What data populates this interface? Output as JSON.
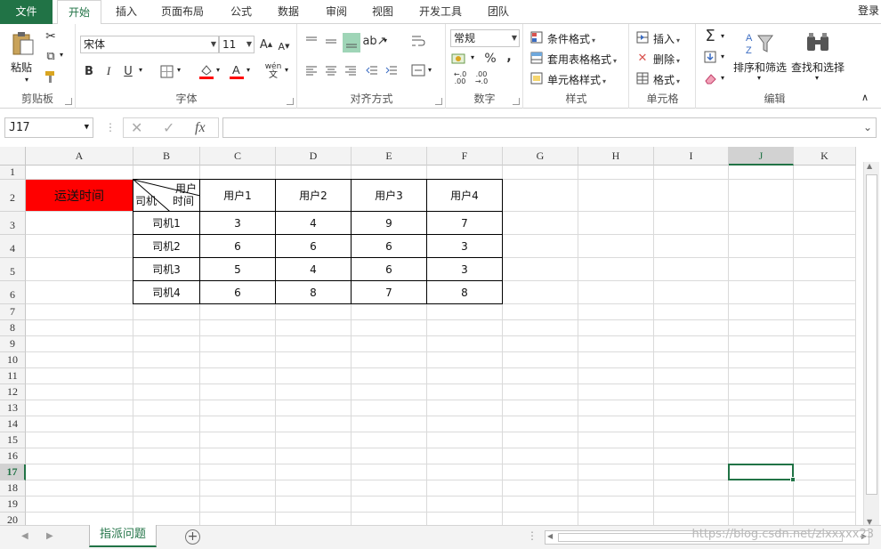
{
  "tabs": {
    "file": "文件",
    "home": "开始",
    "insert": "插入",
    "page_layout": "页面布局",
    "formulas": "公式",
    "data": "数据",
    "review": "审阅",
    "view": "视图",
    "developer": "开发工具",
    "team": "团队",
    "login": "登录"
  },
  "ribbon": {
    "clipboard": {
      "name": "剪贴板",
      "paste": "粘贴"
    },
    "font": {
      "name": "字体",
      "font_name": "宋体",
      "font_size": "11",
      "bold": "B",
      "italic": "I",
      "underline": "U",
      "phonetic": "wén"
    },
    "alignment": {
      "name": "对齐方式"
    },
    "number": {
      "name": "数字",
      "format": "常规",
      "percent": "%",
      "comma": ","
    },
    "styles": {
      "name": "样式",
      "conditional": "条件格式",
      "table": "套用表格格式",
      "cell_styles": "单元格样式"
    },
    "cells": {
      "name": "单元格",
      "insert": "插入",
      "delete": "删除",
      "format": "格式"
    },
    "editing": {
      "name": "编辑",
      "sort_filter": "排序和筛选",
      "find_select": "查找和选择"
    }
  },
  "formula_bar": {
    "name_box": "J17",
    "formula": "",
    "fx": "fx"
  },
  "columns": [
    "A",
    "B",
    "C",
    "D",
    "E",
    "F",
    "G",
    "H",
    "I",
    "J",
    "K"
  ],
  "rows": [
    "1",
    "2",
    "3",
    "4",
    "5",
    "6",
    "7",
    "8",
    "9",
    "10",
    "11",
    "12",
    "13",
    "14",
    "15",
    "16",
    "17",
    "18",
    "19",
    "20"
  ],
  "selected_cell": {
    "column": "J",
    "row": "17"
  },
  "sheet": {
    "title_cell": "运送时间",
    "diagonal_header": {
      "top_right": "用户",
      "bottom_left": "司机",
      "bottom_middle": "时间"
    },
    "col_headers": [
      "用户1",
      "用户2",
      "用户3",
      "用户4"
    ],
    "rows": [
      {
        "label": "司机1",
        "values": [
          "3",
          "4",
          "9",
          "7"
        ]
      },
      {
        "label": "司机2",
        "values": [
          "6",
          "6",
          "6",
          "3"
        ]
      },
      {
        "label": "司机3",
        "values": [
          "5",
          "4",
          "6",
          "3"
        ]
      },
      {
        "label": "司机4",
        "values": [
          "6",
          "8",
          "7",
          "8"
        ]
      }
    ]
  },
  "sheet_tabs": [
    "指派问题"
  ],
  "watermark": "https://blog.csdn.net/zlxxxxx23",
  "colors": {
    "excel_green": "#217346",
    "title_fill": "#ff0000"
  }
}
